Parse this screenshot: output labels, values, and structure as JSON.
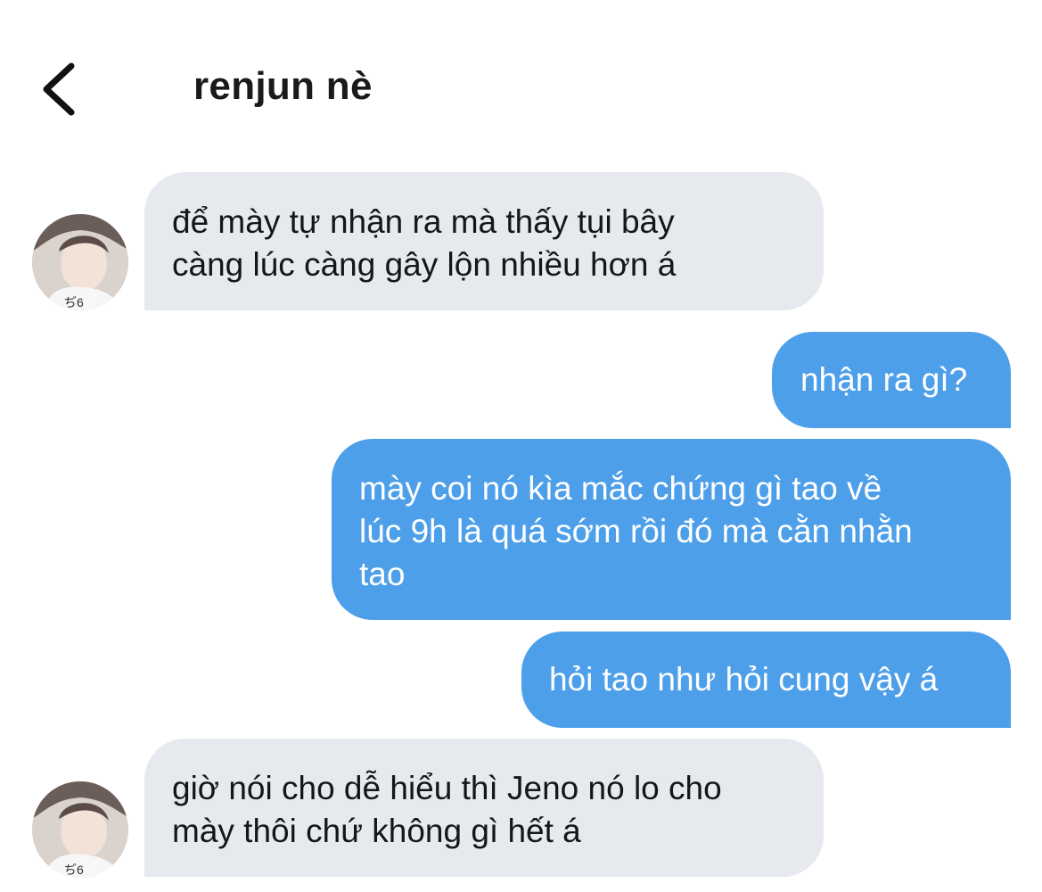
{
  "header": {
    "back_icon": "chevron-left-icon",
    "title": "renjun nè"
  },
  "colors": {
    "incoming_bubble": "#e6eaee",
    "outgoing_bubble": "#4d9fea",
    "incoming_text": "#14171a",
    "outgoing_text": "#ffffff"
  },
  "messages": [
    {
      "direction": "incoming",
      "text": "để mày tự nhận ra mà thấy tụi bây\ncàng lúc càng gây lộn nhiều hơn á"
    },
    {
      "direction": "outgoing",
      "text": "nhận ra gì?"
    },
    {
      "direction": "outgoing",
      "text": "mày coi nó kìa mắc chứng gì tao về\nlúc 9h là quá sớm rồi đó mà cằn nhằn\ntao"
    },
    {
      "direction": "outgoing",
      "text": "hỏi tao như hỏi cung vậy á"
    },
    {
      "direction": "incoming",
      "text": "giờ nói cho dễ hiểu thì Jeno nó lo cho\nmày thôi chứ không gì hết á"
    }
  ]
}
